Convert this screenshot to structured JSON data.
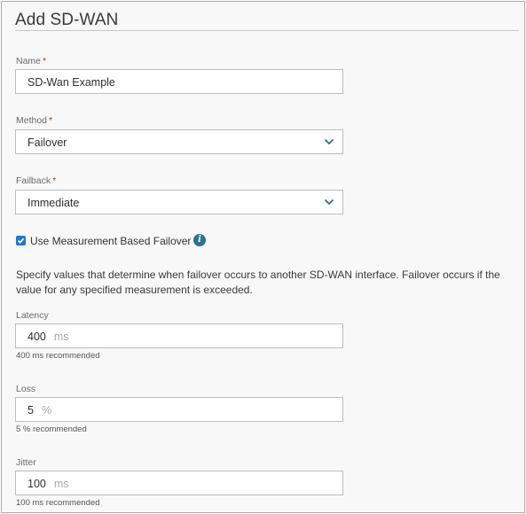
{
  "dialog": {
    "title": "Add SD-WAN"
  },
  "required_marker": "*",
  "name_field": {
    "label": "Name",
    "value": "SD-Wan Example"
  },
  "method_field": {
    "label": "Method",
    "selected": "Failover",
    "icon": "chevron-down-icon"
  },
  "failback_field": {
    "label": "Failback",
    "selected": "Immediate",
    "icon": "chevron-down-icon"
  },
  "measurement_checkbox": {
    "label": "Use Measurement Based Failover",
    "checked": true,
    "info_icon": "info-icon",
    "info_glyph": "i"
  },
  "description": "Specify values that determine when failover occurs to another SD-WAN interface. Failover occurs if the value for any specified measurement is exceeded.",
  "latency": {
    "label": "Latency",
    "value": "400",
    "unit": "ms",
    "hint": "400 ms recommended"
  },
  "loss": {
    "label": "Loss",
    "value": "5",
    "unit": "%",
    "hint": "5 % recommended"
  },
  "jitter": {
    "label": "Jitter",
    "value": "100",
    "unit": "ms",
    "hint": "100 ms recommended"
  },
  "colors": {
    "accent": "#2478cc",
    "info_icon": "#2d7391",
    "required": "#d1252a",
    "background": "#f8f8f8"
  }
}
